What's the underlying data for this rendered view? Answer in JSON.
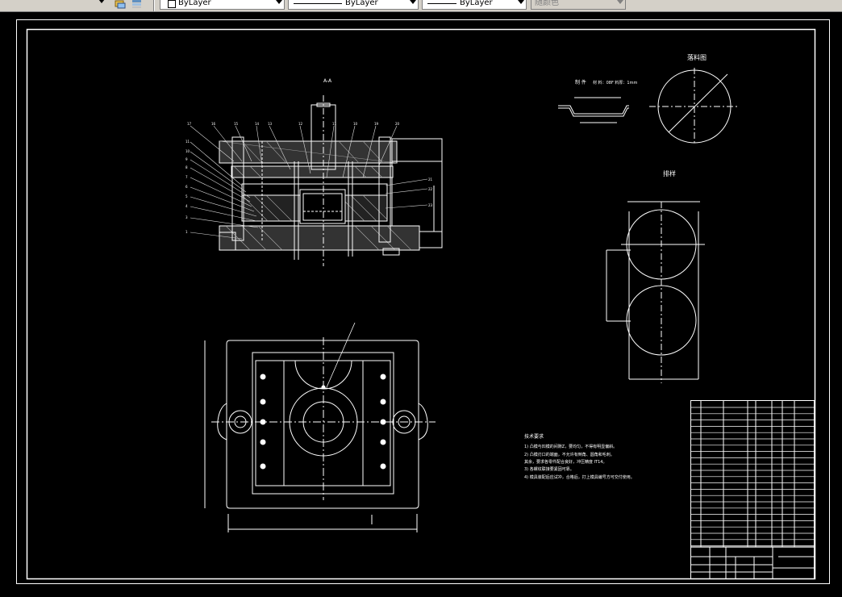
{
  "toolbar": {
    "color_select": "ByLayer",
    "linetype_select": "ByLayer",
    "lineweight_select": "ByLayer",
    "plotstyle_select": "随颜色"
  },
  "drawing": {
    "section_label": "A-A",
    "part_label": "制 件",
    "part_note": "材 料：08F   料厚：1mm",
    "blank_label": "落料图",
    "layout_label": "排样",
    "tech_title": "技术要求",
    "tech_lines": [
      "1) 凸模与凹模的间隙Z，要均匀，不得有明显偏斜。",
      "2) 凸模刃口的端面，不允许有倒角、圆角和毛刺。",
      "   其余，要求各零件配合良好，冲压精度 IT14。",
      "3) 各螺纹联接要紧固可靠。",
      "4) 模具装配后应试冲，合格后，打上模具编号方可交付使用。"
    ]
  }
}
